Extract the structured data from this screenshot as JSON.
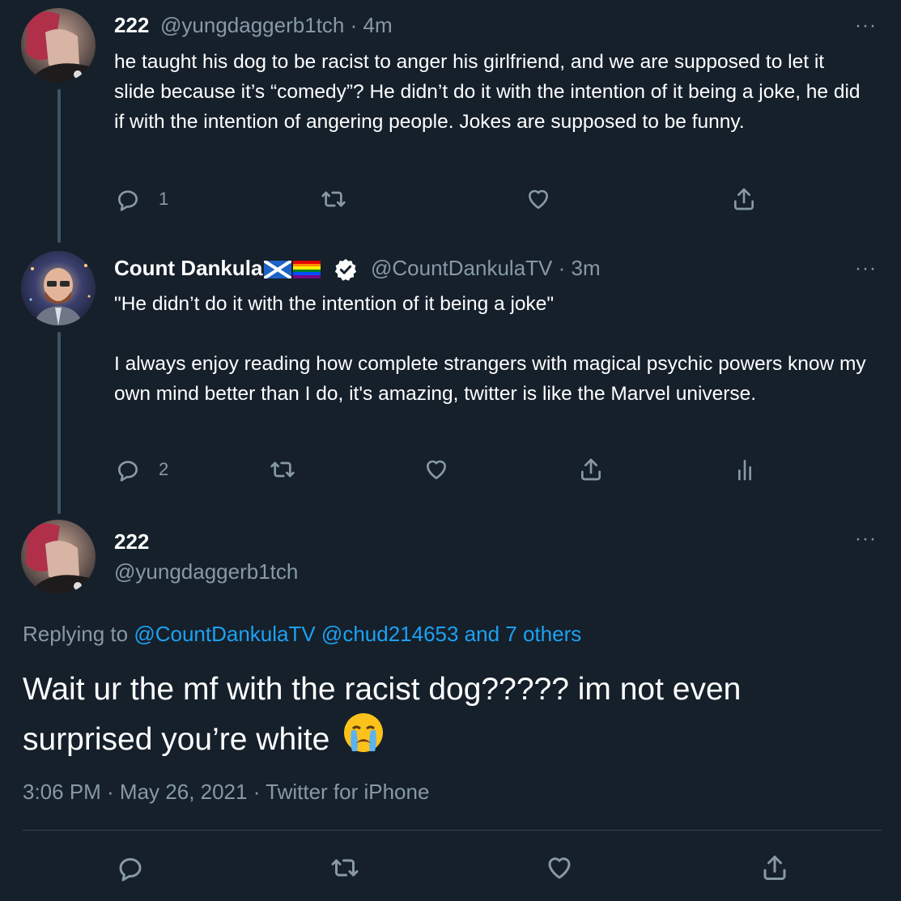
{
  "tweet1": {
    "name": "222",
    "handle": "@yungdaggerb1tch",
    "separator": "·",
    "time": "4m",
    "text": "he taught his dog to be racist to anger his girlfriend, and we are supposed to let it slide because it’s “comedy”? He didn’t do it with the intention of it being a joke, he did if with the intention of angering people. Jokes are supposed to be funny.",
    "reply_count": "1",
    "more": "···"
  },
  "tweet2": {
    "name": "Count Dankula",
    "verified": true,
    "handle": "@CountDankulaTV",
    "separator": "·",
    "time": "3m",
    "text": "\"He didn’t do it with the intention of it being a joke\"\n\nI always enjoy reading how complete strangers with magical psychic powers know my own mind better than I do, it's amazing, twitter is like the Marvel universe.",
    "reply_count": "2",
    "more": "···"
  },
  "main": {
    "name": "222",
    "handle": "@yungdaggerb1tch",
    "more": "···",
    "replying_prefix": "Replying to",
    "replying_to": "@CountDankulaTV @chud214653 and 7 others",
    "text": "Wait ur the mf with the racist dog????? im not even surprised you’re white",
    "emoji": "😭",
    "meta": "3:06 PM · May 26, 2021 · Twitter for iPhone"
  },
  "icons": [
    "reply-icon",
    "retweet-icon",
    "like-icon",
    "share-icon",
    "analytics-icon",
    "verified-icon",
    "scotland-flag-icon",
    "rainbow-flag-icon"
  ],
  "colors": {
    "background": "#15202b",
    "text": "#ffffff",
    "muted": "#8899a6",
    "link": "#1da1f2",
    "thread_line": "#3d5466",
    "divider": "#38444d"
  }
}
